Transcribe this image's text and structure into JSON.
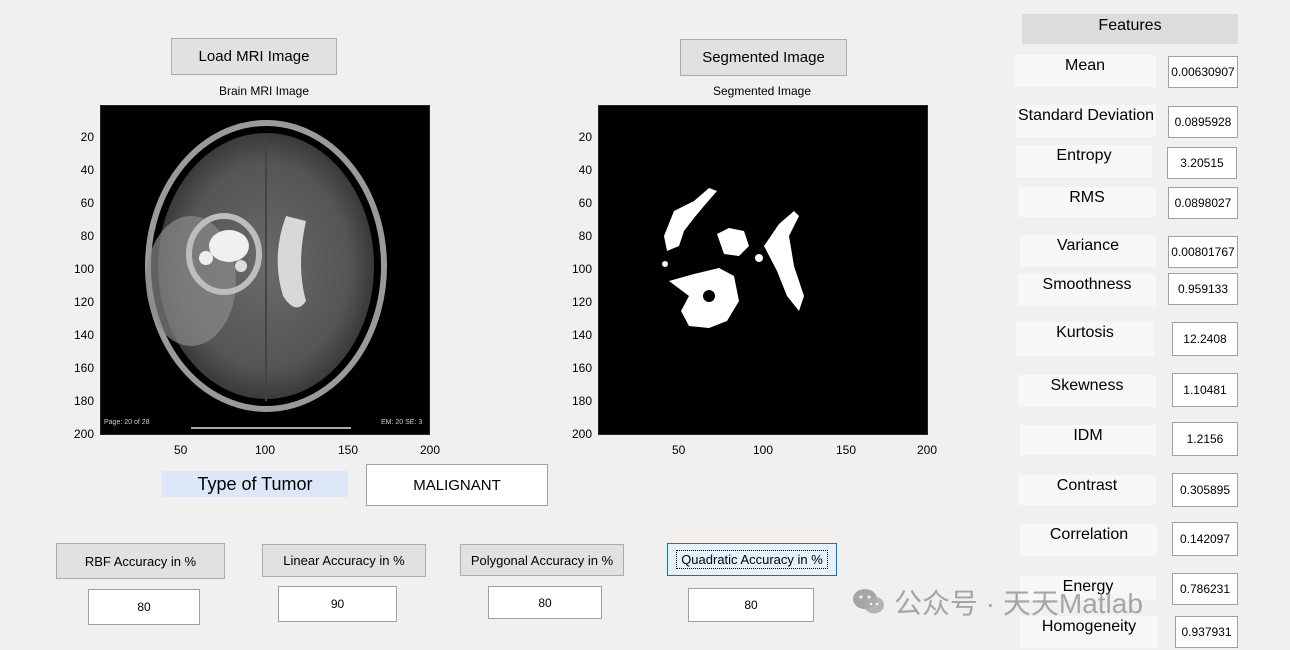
{
  "buttons": {
    "load": "Load MRI Image",
    "segmented": "Segmented Image"
  },
  "plots": {
    "brain_title": "Brain MRI Image",
    "seg_title": "Segmented Image",
    "yticks": [
      "20",
      "40",
      "60",
      "80",
      "100",
      "120",
      "140",
      "160",
      "180",
      "200"
    ],
    "xticks": [
      "50",
      "100",
      "150",
      "200"
    ],
    "mri_overlay_left": "Page: 20 of 28",
    "mri_overlay_right": "EM: 20 SE: 3"
  },
  "tumor": {
    "label": "Type of Tumor",
    "value": "MALIGNANT"
  },
  "accuracy": {
    "rbf_label": "RBF Accuracy in %",
    "rbf_value": "80",
    "linear_label": "Linear Accuracy in %",
    "linear_value": "90",
    "polygonal_label": "Polygonal Accuracy in %",
    "polygonal_value": "80",
    "quadratic_label": "Quadratic Accuracy in %",
    "quadratic_value": "80"
  },
  "features": {
    "header": "Features",
    "items": [
      {
        "label": "Mean",
        "value": "0.00630907"
      },
      {
        "label": "Standard Deviation",
        "value": "0.0895928"
      },
      {
        "label": "Entropy",
        "value": "3.20515"
      },
      {
        "label": "RMS",
        "value": "0.0898027"
      },
      {
        "label": "Variance",
        "value": "0.00801767"
      },
      {
        "label": "Smoothness",
        "value": "0.959133"
      },
      {
        "label": "Kurtosis",
        "value": "12.2408"
      },
      {
        "label": "Skewness",
        "value": "1.10481"
      },
      {
        "label": "IDM",
        "value": "1.2156"
      },
      {
        "label": "Contrast",
        "value": "0.305895"
      },
      {
        "label": "Correlation",
        "value": "0.142097"
      },
      {
        "label": "Energy",
        "value": "0.786231"
      },
      {
        "label": "Homogeneity",
        "value": "0.937931"
      }
    ]
  },
  "watermark": "公众号 · 天天Matlab",
  "icons": {
    "watermark_logo": "wechat-icon"
  }
}
